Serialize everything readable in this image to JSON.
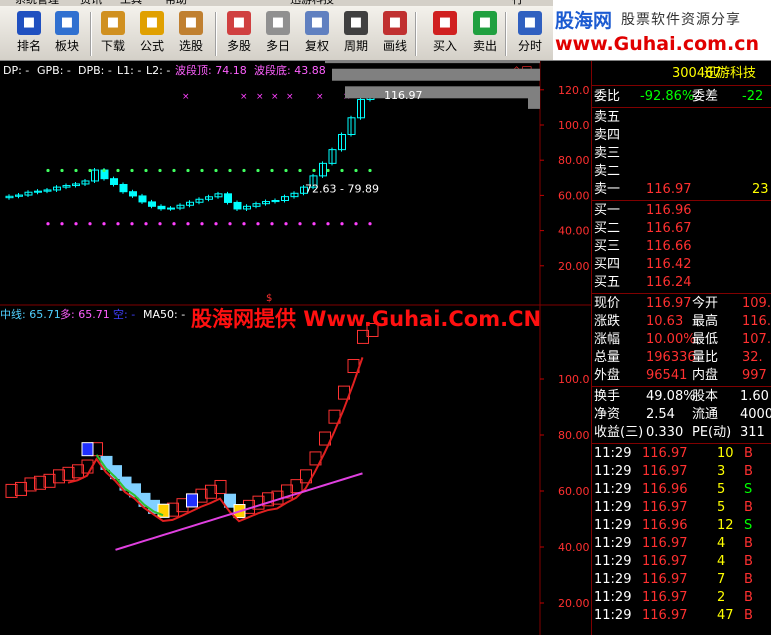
{
  "menubar": {
    "items": [
      "系统管理",
      "资讯",
      "工具",
      "帮助",
      "迅游科技",
      "行"
    ]
  },
  "toolbar": [
    {
      "label": "排名",
      "icon": "ranking-icon",
      "color": "#2050c0"
    },
    {
      "label": "板块",
      "icon": "sector-icon",
      "color": "#3070d0"
    },
    {
      "label": "下载",
      "icon": "download-icon",
      "color": "#d09020"
    },
    {
      "label": "公式",
      "icon": "formula-icon",
      "color": "#e0a000"
    },
    {
      "label": "选股",
      "icon": "stock-picker-icon",
      "color": "#c08030"
    },
    {
      "label": "多股",
      "icon": "multi-stock-icon",
      "color": "#d04040"
    },
    {
      "label": "多日",
      "icon": "multi-day-icon",
      "color": "#909090"
    },
    {
      "label": "复权",
      "icon": "rights-adjust-icon",
      "color": "#6080c0"
    },
    {
      "label": "周期",
      "icon": "period-icon",
      "color": "#404040"
    },
    {
      "label": "画线",
      "icon": "draw-line-icon",
      "color": "#c03030"
    },
    {
      "label": "买入",
      "icon": "buy-icon",
      "color": "#d02020"
    },
    {
      "label": "卖出",
      "icon": "sell-icon",
      "color": "#20a040"
    },
    {
      "label": "分时",
      "icon": "intraday-icon",
      "color": "#3060c0"
    }
  ],
  "logo": {
    "line1a": "股海网",
    "line1b": "股票软件资源分享",
    "line2": "www.Guhai.com.cn"
  },
  "upper": {
    "label_dp": "DP: -",
    "label_gpb": "GPB: -",
    "label_dpb": "DPB: -",
    "label_l1": "L1: -",
    "label_l2": "L2: -",
    "label_top": "波段顶: 74.18",
    "label_bottom": "波段底: 43.88",
    "price_tag": "116.97",
    "range_tag": "72.63 - 79.89",
    "axis": [
      "120.0",
      "100.0",
      "80.00",
      "60.00",
      "40.00",
      "20.00"
    ]
  },
  "lower": {
    "label_mid": "中线: 65.71",
    "label_long": "多: 65.71",
    "label_short": "空: -",
    "label_ma": "MA50: -",
    "axis": [
      "100.0",
      "80.00",
      "60.00",
      "40.00",
      "20.00"
    ]
  },
  "watermark": "股海网提供  Www.Guhai.Com.CN",
  "side": {
    "code": "300467",
    "name": "迅游科技",
    "weibi_label": "委比",
    "weibi": "-92.86%",
    "weicha_label": "委差",
    "weicha": "-22",
    "sells": [
      {
        "l": "卖五",
        "p": "",
        "v": ""
      },
      {
        "l": "卖四",
        "p": "",
        "v": ""
      },
      {
        "l": "卖三",
        "p": "",
        "v": ""
      },
      {
        "l": "卖二",
        "p": "",
        "v": ""
      },
      {
        "l": "卖一",
        "p": "116.97",
        "v": "23"
      }
    ],
    "buys": [
      {
        "l": "买一",
        "p": "116.96"
      },
      {
        "l": "买二",
        "p": "116.67"
      },
      {
        "l": "买三",
        "p": "116.66"
      },
      {
        "l": "买四",
        "p": "116.42"
      },
      {
        "l": "买五",
        "p": "116.24"
      }
    ],
    "stats": [
      {
        "a": "现价",
        "av": "116.97",
        "b": "今开",
        "bv": "109."
      },
      {
        "a": "涨跌",
        "av": "10.63",
        "b": "最高",
        "bv": "116."
      },
      {
        "a": "涨幅",
        "av": "10.00%",
        "b": "最低",
        "bv": "107."
      },
      {
        "a": "总量",
        "av": "196336",
        "b": "量比",
        "bv": "32."
      },
      {
        "a": "外盘",
        "av": "96541",
        "b": "内盘",
        "bv": "997"
      }
    ],
    "stats2": [
      {
        "a": "换手",
        "av": "49.08%",
        "b": "股本",
        "bv": "1.60"
      },
      {
        "a": "净资",
        "av": "2.54",
        "b": "流通",
        "bv": "4000"
      },
      {
        "a": "收益(三)",
        "av": "0.330",
        "b": "PE(动)",
        "bv": "311"
      }
    ],
    "ticks": [
      {
        "t": "11:29",
        "p": "116.97",
        "v": "10",
        "d": "B"
      },
      {
        "t": "11:29",
        "p": "116.97",
        "v": "3",
        "d": "B"
      },
      {
        "t": "11:29",
        "p": "116.96",
        "v": "5",
        "d": "S"
      },
      {
        "t": "11:29",
        "p": "116.97",
        "v": "5",
        "d": "B"
      },
      {
        "t": "11:29",
        "p": "116.96",
        "v": "12",
        "d": "S"
      },
      {
        "t": "11:29",
        "p": "116.97",
        "v": "4",
        "d": "B"
      },
      {
        "t": "11:29",
        "p": "116.97",
        "v": "4",
        "d": "B"
      },
      {
        "t": "11:29",
        "p": "116.97",
        "v": "7",
        "d": "B"
      },
      {
        "t": "11:29",
        "p": "116.97",
        "v": "2",
        "d": "B"
      },
      {
        "t": "11:29",
        "p": "116.97",
        "v": "47",
        "d": "B"
      }
    ]
  },
  "colors": {
    "up": "#ff3232",
    "down": "#54fcfc",
    "volume_ma": "#a000a0",
    "panel_border": "#800000"
  },
  "chart_data": [
    {
      "type": "candlestick",
      "title": "",
      "ylim": [
        0,
        125
      ],
      "closes": [
        59.5,
        60.2,
        61.8,
        62.4,
        63.1,
        64.7,
        65.6,
        66.5,
        68.2,
        74.4,
        69.5,
        66.2,
        62.1,
        59.7,
        56.3,
        53.8,
        52.4,
        52.8,
        54.4,
        56.1,
        57.8,
        59.2,
        60.9,
        56.0,
        52.3,
        53.8,
        55.3,
        56.5,
        57.1,
        59.3,
        61.2,
        64.7,
        71.1,
        78.2,
        86.0,
        94.6,
        104.1,
        114.5,
        116.97
      ],
      "dotted_levels": [
        74.18,
        43.88
      ],
      "price_marker": 116.97
    },
    {
      "type": "line",
      "title": "",
      "ylim": [
        10,
        120
      ],
      "mid_line": 65.71,
      "series_long_last": 65.71
    }
  ]
}
